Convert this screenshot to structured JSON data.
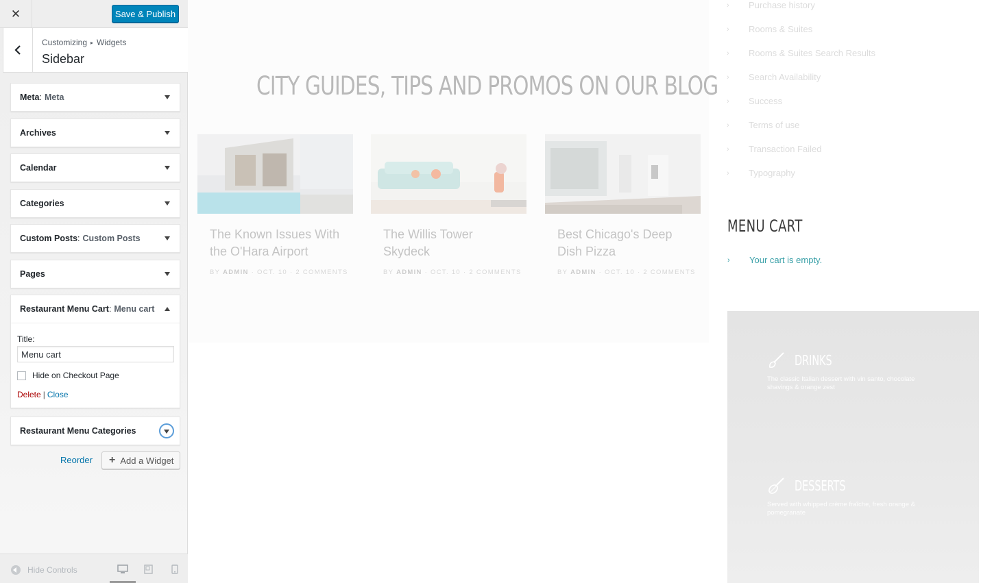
{
  "customizer": {
    "close_icon": "close-icon",
    "publish_label": "Save & Publish",
    "breadcrumb": {
      "root": "Customizing",
      "section": "Widgets"
    },
    "section_title": "Sidebar",
    "widgets": [
      {
        "name": "Meta",
        "subtitle": "Meta"
      },
      {
        "name": "Archives",
        "subtitle": ""
      },
      {
        "name": "Calendar",
        "subtitle": ""
      },
      {
        "name": "Categories",
        "subtitle": ""
      },
      {
        "name": "Custom Posts",
        "subtitle": "Custom Posts"
      },
      {
        "name": "Pages",
        "subtitle": ""
      },
      {
        "name": "Restaurant Menu Cart",
        "subtitle": "Menu cart"
      },
      {
        "name": "Restaurant Menu Categories",
        "subtitle": ""
      }
    ],
    "expanded_widget": {
      "title_label": "Title:",
      "title_value": "Menu cart",
      "checkbox_label": "Hide on Checkout Page",
      "checkbox_checked": false,
      "delete_label": "Delete",
      "separator": "|",
      "close_label": "Close"
    },
    "reorder_label": "Reorder",
    "add_widget_label": "Add a Widget",
    "hide_controls_label": "Hide Controls",
    "colors": {
      "primary_button": "#0085ba",
      "link": "#0073aa",
      "delete": "#aa0000"
    }
  },
  "preview": {
    "blog_heading": "CITY GUIDES, TIPS AND PROMOS ON OUR BLOG",
    "posts": [
      {
        "title": "The Known Issues With the O'Hara Airport",
        "by": "BY",
        "author": "ADMIN",
        "date": "OCT. 10",
        "comments": "2 COMMENTS"
      },
      {
        "title": "The Willis Tower Skydeck",
        "by": "BY",
        "author": "ADMIN",
        "date": "OCT. 10",
        "comments": "2 COMMENTS"
      },
      {
        "title": "Best Chicago's Deep Dish Pizza",
        "by": "BY",
        "author": "ADMIN",
        "date": "OCT. 10",
        "comments": "2 COMMENTS"
      }
    ],
    "pages_list": [
      "Purchase history",
      "Rooms & Suites",
      "Rooms & Suites Search Results",
      "Search Availability",
      "Success",
      "Terms of use",
      "Transaction Failed",
      "Typography"
    ],
    "menu_cart_heading": "MENU CART",
    "cart_empty_text": "Your cart is empty.",
    "menu_items": [
      {
        "name": "DRINKS",
        "description": "The classic Italian dessert with vin santo, chocolate shavings & orange zest"
      },
      {
        "name": "DESSERTS",
        "description": "Served with whipped crème fraîche, fresh orange & pomegranate"
      }
    ],
    "colors": {
      "accent": "#3aa0a8"
    }
  }
}
